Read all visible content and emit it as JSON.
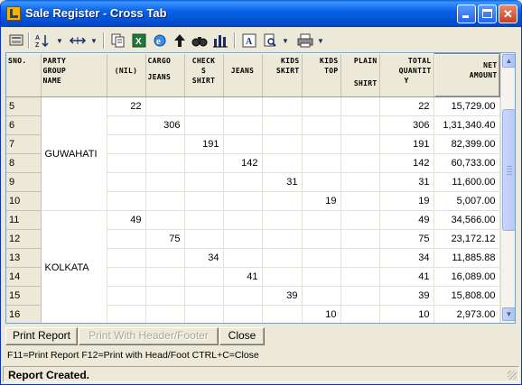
{
  "window": {
    "title": "Sale Register - Cross Tab",
    "colors": {
      "titlebar": "#0255D6",
      "close_button": "#C8401E",
      "grid_border": "#7F9DB9"
    }
  },
  "toolbar": {
    "icons": [
      "print-setup-icon",
      "sort-icon",
      "column-width-icon",
      "copy-icon",
      "excel-export-icon",
      "ie-browser-icon",
      "up-arrow-icon",
      "find-icon",
      "bar-chart-icon",
      "font-icon",
      "print-preview-icon",
      "printer-icon"
    ],
    "sort_label": "A Z",
    "font_label": "A"
  },
  "grid": {
    "headers": {
      "sno": "SNO.",
      "party_line1": "PARTY",
      "party_line2": "GROUP",
      "party_line3": "NAME",
      "nil": "(NIL)",
      "cargo_l1": "CARGO",
      "cargo_l2": "JEANS",
      "checks_l1": "CHECK",
      "checks_l2": "S",
      "checks_l3": "SHIRT",
      "jeans": "JEANS",
      "kids_skirt_l1": "KIDS",
      "kids_skirt_l2": "SKIRT",
      "kids_top_l1": "KIDS",
      "kids_top_l2": "TOP",
      "plain_l1": "PLAIN",
      "plain_l2": "SHIRT",
      "total_l1": "TOTAL",
      "total_l2": "QUANTIT",
      "total_l3": "Y",
      "net_l1": "NET",
      "net_l2": "AMOUNT"
    },
    "rows": [
      {
        "sno": "5",
        "nil": "22",
        "cargo": "",
        "checks": "",
        "jeans": "",
        "kids_skirt": "",
        "kids_top": "",
        "plain": "",
        "total": "22",
        "net": "15,729.00"
      },
      {
        "sno": "6",
        "nil": "",
        "cargo": "306",
        "checks": "",
        "jeans": "",
        "kids_skirt": "",
        "kids_top": "",
        "plain": "",
        "total": "306",
        "net": "1,31,340.40"
      },
      {
        "sno": "7",
        "nil": "",
        "cargo": "",
        "checks": "191",
        "jeans": "",
        "kids_skirt": "",
        "kids_top": "",
        "plain": "",
        "total": "191",
        "net": "82,399.00"
      },
      {
        "sno": "8",
        "nil": "",
        "cargo": "",
        "checks": "",
        "jeans": "142",
        "kids_skirt": "",
        "kids_top": "",
        "plain": "",
        "total": "142",
        "net": "60,733.00"
      },
      {
        "sno": "9",
        "nil": "",
        "cargo": "",
        "checks": "",
        "jeans": "",
        "kids_skirt": "31",
        "kids_top": "",
        "plain": "",
        "total": "31",
        "net": "11,600.00"
      },
      {
        "sno": "10",
        "nil": "",
        "cargo": "",
        "checks": "",
        "jeans": "",
        "kids_skirt": "",
        "kids_top": "19",
        "plain": "",
        "total": "19",
        "net": "5,007.00"
      },
      {
        "sno": "11",
        "nil": "49",
        "cargo": "",
        "checks": "",
        "jeans": "",
        "kids_skirt": "",
        "kids_top": "",
        "plain": "",
        "total": "49",
        "net": "34,566.00"
      },
      {
        "sno": "12",
        "nil": "",
        "cargo": "75",
        "checks": "",
        "jeans": "",
        "kids_skirt": "",
        "kids_top": "",
        "plain": "",
        "total": "75",
        "net": "23,172.12"
      },
      {
        "sno": "13",
        "nil": "",
        "cargo": "",
        "checks": "34",
        "jeans": "",
        "kids_skirt": "",
        "kids_top": "",
        "plain": "",
        "total": "34",
        "net": "11,885.88"
      },
      {
        "sno": "14",
        "nil": "",
        "cargo": "",
        "checks": "",
        "jeans": "41",
        "kids_skirt": "",
        "kids_top": "",
        "plain": "",
        "total": "41",
        "net": "16,089.00"
      },
      {
        "sno": "15",
        "nil": "",
        "cargo": "",
        "checks": "",
        "jeans": "",
        "kids_skirt": "39",
        "kids_top": "",
        "plain": "",
        "total": "39",
        "net": "15,808.00"
      },
      {
        "sno": "16",
        "nil": "",
        "cargo": "",
        "checks": "",
        "jeans": "",
        "kids_skirt": "",
        "kids_top": "10",
        "plain": "",
        "total": "10",
        "net": "2,973.00"
      }
    ],
    "groups": [
      {
        "name": "GUWAHATI"
      },
      {
        "name": "KOLKATA"
      }
    ]
  },
  "buttons": {
    "print_report": "Print Report",
    "print_header_footer": "Print With Header/Footer",
    "close": "Close"
  },
  "help_text": "F11=Print Report  F12=Print with Head/Foot  CTRL+C=Close",
  "status": "Report Created."
}
